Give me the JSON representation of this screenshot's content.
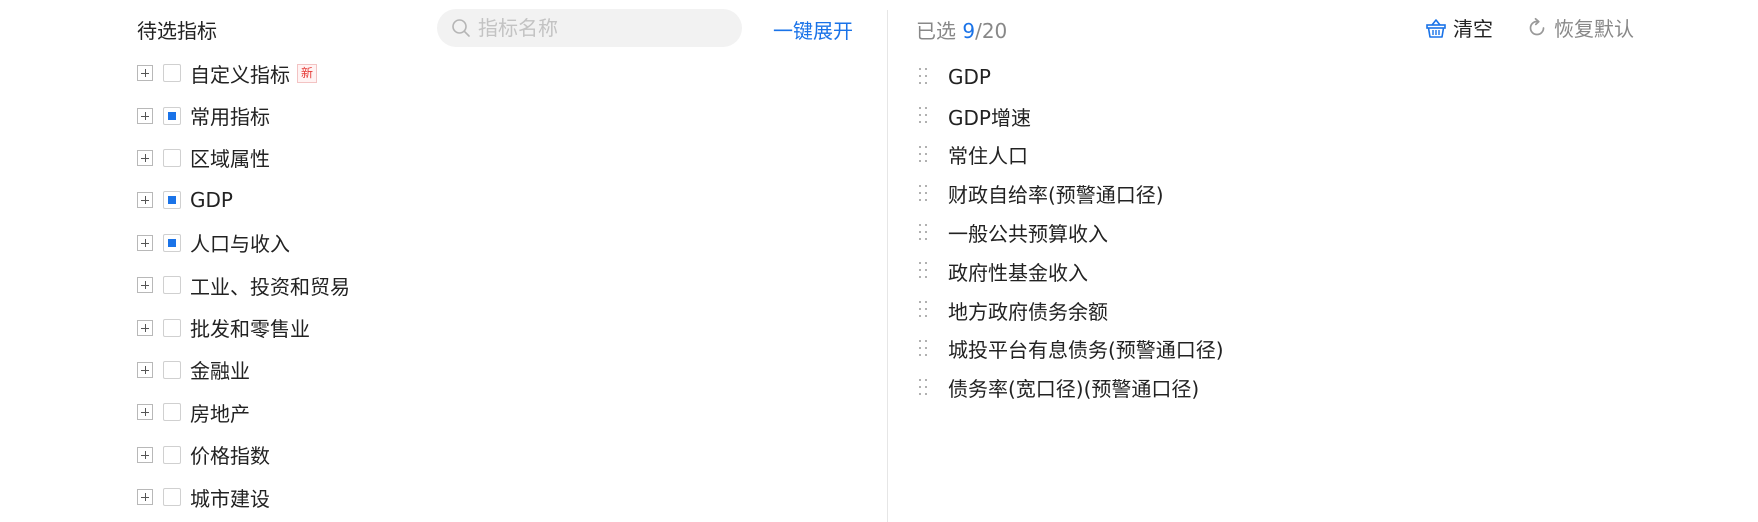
{
  "left": {
    "title": "待选指标",
    "search_placeholder": "指标名称",
    "expand_all": "一键展开",
    "tree": [
      {
        "label": "自定义指标",
        "state": "unchecked",
        "badge": "新"
      },
      {
        "label": "常用指标",
        "state": "partial"
      },
      {
        "label": "区域属性",
        "state": "unchecked"
      },
      {
        "label": "GDP",
        "state": "partial"
      },
      {
        "label": "人口与收入",
        "state": "partial"
      },
      {
        "label": "工业、投资和贸易",
        "state": "unchecked"
      },
      {
        "label": "批发和零售业",
        "state": "unchecked"
      },
      {
        "label": "金融业",
        "state": "unchecked"
      },
      {
        "label": "房地产",
        "state": "unchecked"
      },
      {
        "label": "价格指数",
        "state": "unchecked"
      },
      {
        "label": "城市建设",
        "state": "unchecked"
      }
    ]
  },
  "right": {
    "selected_prefix": "已选",
    "selected_count": "9",
    "selected_total": "/20",
    "clear_label": "清空",
    "reset_label": "恢复默认",
    "items": [
      "GDP",
      "GDP增速",
      "常住人口",
      "财政自给率(预警通口径)",
      "一般公共预算收入",
      "政府性基金收入",
      "地方政府债务余额",
      "城投平台有息债务(预警通口径)",
      "债务率(宽口径)(预警通口径)"
    ]
  },
  "colors": {
    "accent": "#1a73e8",
    "badge": "#e53935",
    "muted": "#888888"
  }
}
